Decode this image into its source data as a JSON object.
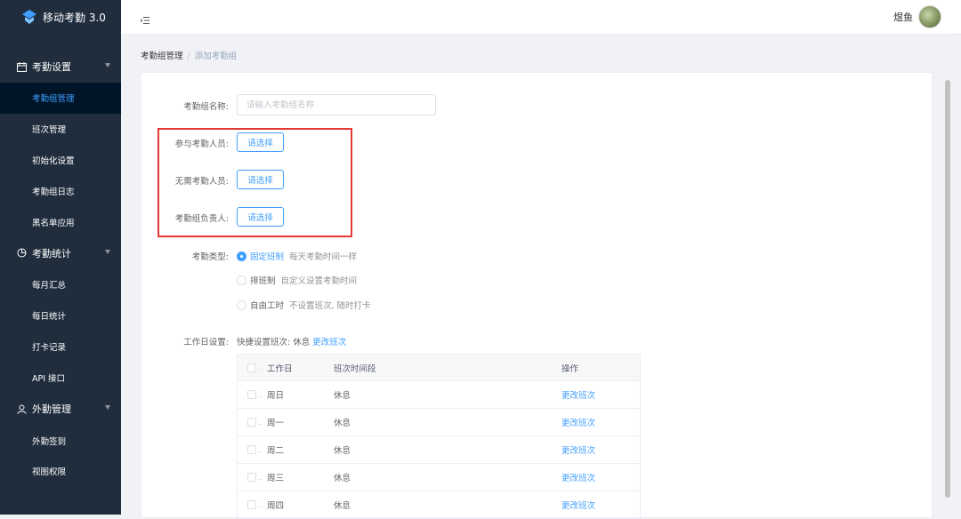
{
  "app": {
    "title": "移动考勤 3.0"
  },
  "sidebar": {
    "groups": [
      {
        "title": "考勤设置",
        "items": [
          "考勤组管理",
          "班次管理",
          "初始化设置",
          "考勤组日志",
          "黑名单应用"
        ]
      },
      {
        "title": "考勤统计",
        "items": [
          "每月汇总",
          "每日统计",
          "打卡记录",
          "API 接口"
        ]
      },
      {
        "title": "外勤管理",
        "items": [
          "外勤签到",
          "视图权限"
        ]
      }
    ]
  },
  "header": {
    "username": "煜鱼"
  },
  "breadcrumb": {
    "parent": "考勤组管理",
    "separator": "/",
    "current": "添加考勤组"
  },
  "form": {
    "name_label": "考勤组名称:",
    "name_placeholder": "请输入考勤组名称",
    "participants_label": "参与考勤人员:",
    "exempt_label": "无需考勤人员:",
    "owner_label": "考勤组负责人:",
    "select_button": "请选择",
    "type_label": "考勤类型:",
    "types": [
      {
        "label": "固定班制",
        "desc": "每天考勤时间一样"
      },
      {
        "label": "排班制",
        "desc": "自定义设置考勤时间"
      },
      {
        "label": "自由工时",
        "desc": "不设置班次, 随时打卡"
      }
    ],
    "workday_label": "工作日设置:",
    "quick_text": "快捷设置班次: 休息",
    "quick_link": "更改班次"
  },
  "table": {
    "headers": {
      "day": "工作日",
      "time": "班次时间段",
      "op": "操作"
    },
    "rows": [
      {
        "day": "周日",
        "time": "休息",
        "op": "更改班次"
      },
      {
        "day": "周一",
        "time": "休息",
        "op": "更改班次"
      },
      {
        "day": "周二",
        "time": "休息",
        "op": "更改班次"
      },
      {
        "day": "周三",
        "time": "休息",
        "op": "更改班次"
      },
      {
        "day": "周四",
        "time": "休息",
        "op": "更改班次"
      }
    ]
  },
  "colors": {
    "primary": "#409eff",
    "sidebar": "#1f2d3d",
    "highlight": "#e53935"
  }
}
